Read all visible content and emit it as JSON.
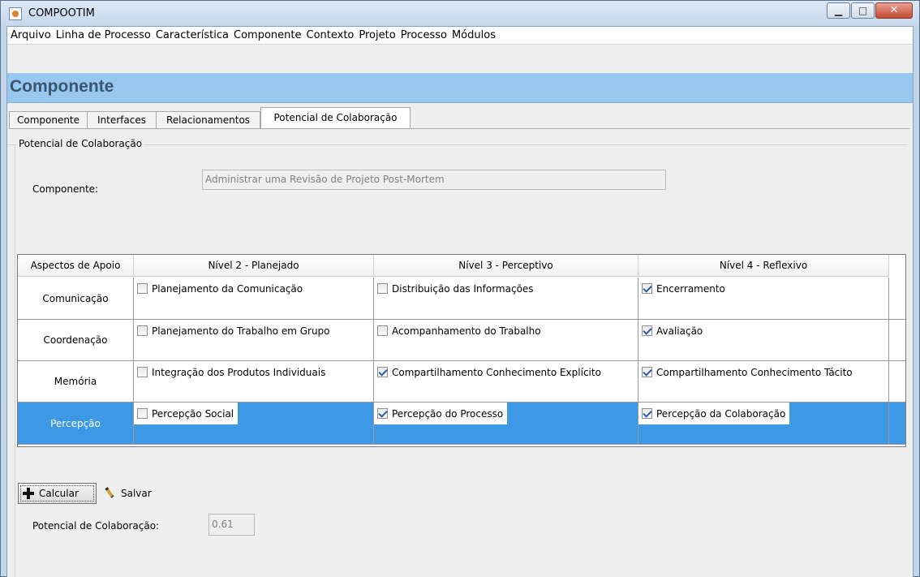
{
  "window": {
    "title": "COMPOOTIM"
  },
  "menu": [
    "Arquivo",
    "Linha de Processo",
    "Característica",
    "Componente",
    "Contexto",
    "Projeto",
    "Processo",
    "Módulos"
  ],
  "header": {
    "title": "Componente"
  },
  "tabs": [
    "Componente",
    "Interfaces",
    "Relacionamentos",
    "Potencial de Colaboração"
  ],
  "active_tab": "Potencial de Colaboração",
  "group": {
    "title": "Potencial de Colaboração"
  },
  "component_field": {
    "label": "Componente:",
    "value": "Administrar uma Revisão de Projeto Post-Mortem"
  },
  "table": {
    "headers": [
      "Aspectos de Apoio",
      "Nível 2 - Planejado",
      "Nível 3 - Perceptivo",
      "Nível 4 - Reflexivo"
    ],
    "rows": [
      {
        "aspect": "Comunicação",
        "selected": false,
        "cells": [
          {
            "label": "Planejamento da Comunicação",
            "checked": false
          },
          {
            "label": "Distribuição das Informações",
            "checked": false
          },
          {
            "label": "Encerramento",
            "checked": true
          }
        ]
      },
      {
        "aspect": "Coordenação",
        "selected": false,
        "cells": [
          {
            "label": "Planejamento do Trabalho em Grupo",
            "checked": false
          },
          {
            "label": "Acompanhamento do Trabalho",
            "checked": false
          },
          {
            "label": "Avaliação",
            "checked": true
          }
        ]
      },
      {
        "aspect": "Memória",
        "selected": false,
        "cells": [
          {
            "label": "Integração dos Produtos Individuais",
            "checked": false
          },
          {
            "label": "Compartilhamento Conhecimento Explícito",
            "checked": true
          },
          {
            "label": "Compartilhamento Conhecimento Tácito",
            "checked": true
          }
        ]
      },
      {
        "aspect": "Percepção",
        "selected": true,
        "cells": [
          {
            "label": "Percepção Social",
            "checked": false
          },
          {
            "label": "Percepção do Processo",
            "checked": true
          },
          {
            "label": "Percepção da Colaboração",
            "checked": true
          }
        ]
      }
    ]
  },
  "buttons": {
    "calcular": "Calcular",
    "salvar": "Salvar"
  },
  "result": {
    "label": "Potencial de Colaboração:",
    "value": "0.61"
  },
  "colors": {
    "header_band": "#98c7f0",
    "selection": "#3d99e6"
  }
}
